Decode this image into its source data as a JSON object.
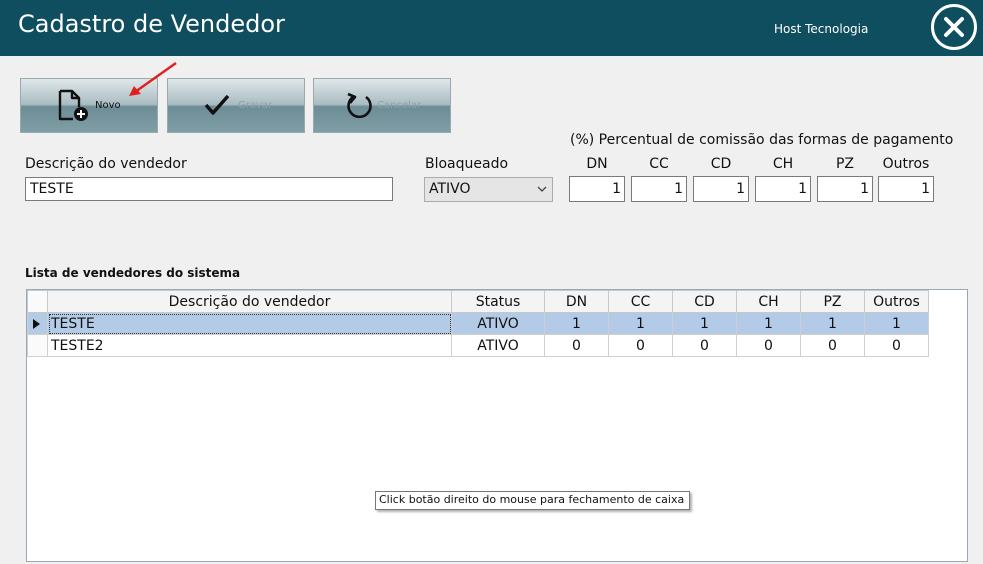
{
  "window": {
    "title": "Cadastro de Vendedor",
    "company": "Host Tecnologia"
  },
  "toolbar": {
    "novo_label": "Novo",
    "gravar_label": "Gravar",
    "cancelar_label": "Cancelar"
  },
  "form": {
    "descricao_label": "Descrição do vendedor",
    "descricao_value": "TESTE",
    "bloqueado_label": "Bloaqueado",
    "bloqueado_value": "ATIVO",
    "percentual_label": "(%) Percentual de comissão das formas de pagamento",
    "commission": [
      {
        "label": "DN",
        "value": "1"
      },
      {
        "label": "CC",
        "value": "1"
      },
      {
        "label": "CD",
        "value": "1"
      },
      {
        "label": "CH",
        "value": "1"
      },
      {
        "label": "PZ",
        "value": "1"
      },
      {
        "label": "Outros",
        "value": "1"
      }
    ]
  },
  "list": {
    "title": "Lista de vendedores do sistema",
    "columns": [
      "Descrição do vendedor",
      "Status",
      "DN",
      "CC",
      "CD",
      "CH",
      "PZ",
      "Outros"
    ],
    "rows": [
      [
        "TESTE",
        "ATIVO",
        "1",
        "1",
        "1",
        "1",
        "1",
        "1"
      ],
      [
        "TESTE2",
        "ATIVO",
        "0",
        "0",
        "0",
        "0",
        "0",
        "0"
      ]
    ],
    "selected_row": 0
  },
  "tooltip": {
    "text": "Click botão direito do mouse para fechamento de caixa"
  },
  "colors": {
    "titlebar": "#0e4e5e",
    "selected_row": "#b4cbe8",
    "annotation_arrow": "#e02020"
  }
}
